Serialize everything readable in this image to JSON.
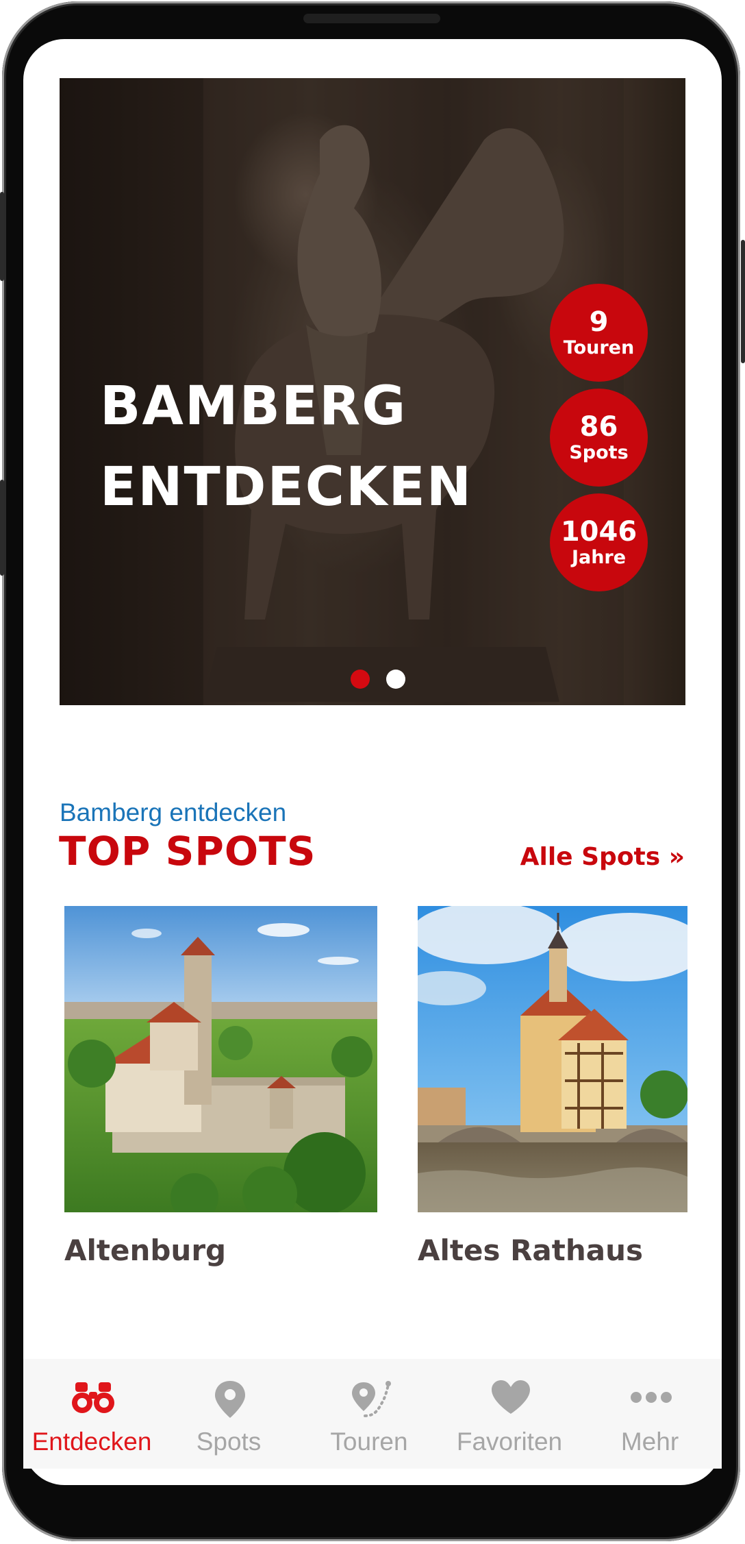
{
  "hero": {
    "title_line1": "BAMBERG",
    "title_line2": "ENTDECKEN",
    "stats": [
      {
        "value": "9",
        "label": "Touren"
      },
      {
        "value": "86",
        "label": "Spots"
      },
      {
        "value": "1046",
        "label": "Jahre"
      }
    ],
    "carousel": {
      "pages": 2,
      "active_page": 1
    }
  },
  "section": {
    "kicker": "Bamberg entdecken",
    "title": "TOP SPOTS",
    "all_link": "Alle Spots »"
  },
  "spots": [
    {
      "title": "Altenburg"
    },
    {
      "title": "Altes Rathaus"
    }
  ],
  "bottom_nav": {
    "items": [
      {
        "label": "Entdecken",
        "icon": "binoculars-icon",
        "active": true
      },
      {
        "label": "Spots",
        "icon": "map-pin-icon",
        "active": false
      },
      {
        "label": "Touren",
        "icon": "route-icon",
        "active": false
      },
      {
        "label": "Favoriten",
        "icon": "heart-icon",
        "active": false
      },
      {
        "label": "Mehr",
        "icon": "more-dots-icon",
        "active": false
      }
    ]
  },
  "colors": {
    "accent_red": "#c8070d",
    "kicker_blue": "#1a74b8",
    "nav_inactive": "#a6a6a6",
    "nav_active": "#e0161b"
  }
}
